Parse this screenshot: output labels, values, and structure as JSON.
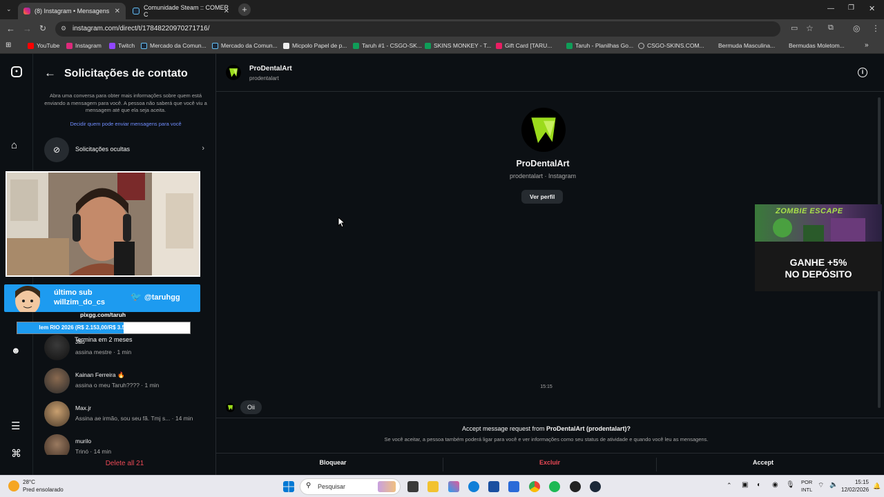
{
  "browser": {
    "tabs": [
      {
        "label": "(8) Instagram • Mensagens",
        "active": true
      },
      {
        "label": "Comunidade Steam :: COMER C",
        "active": false
      }
    ],
    "url": "instagram.com/direct/t/17848220970271716/",
    "bookmarks": [
      "YouTube",
      "Instagram",
      "Twitch",
      "Mercado da Comun...",
      "Mercado da Comun...",
      "Micpolo Papel de p...",
      "Taruh #1 - CSGO-SK...",
      "SKINS MONKEY - T...",
      "Gift Card [TARU...",
      "Taruh - Planilhas Go...",
      "CSGO-SKINS.COM...",
      "Bermuda Masculina...",
      "Bermudas Moletom..."
    ]
  },
  "panel": {
    "title": "Solicitações de contato",
    "info": "Abra uma conversa para obter mais informações sobre quem está enviando a mensagem para você. A pessoa não saberá que você viu a mensagem até que ela seja aceita.",
    "link": "Decidir quem pode enviar mensagens para você",
    "hidden_requests": "Solicitações ocultas",
    "requests": [
      {
        "name": "Jão",
        "preview": "assina mestre · 1 min"
      },
      {
        "name": "Kainan Ferreira 🔥",
        "preview": "assina o meu Taruh???? · 1 min"
      },
      {
        "name": "Max.jr",
        "preview": "Assina ae irmão, sou seu fã. Tmj s... · 14 min"
      },
      {
        "name": "murilo",
        "preview": "Trinó · 14 min"
      }
    ],
    "delete_all": "Delete all 21"
  },
  "overlay": {
    "sub_label": "último sub",
    "sub_name": "willzim_do_cs",
    "twitter": "@taruhgg",
    "pix": "pixgg.com/taruh",
    "goal": "Iem RIO 2026 (R$ 2.153,00/R$ 3.500,00)",
    "goal_progress": 0.615,
    "goal_caption": "Termina em 2 meses"
  },
  "chat": {
    "header_name": "ProDentalArt",
    "header_user": "prodentalart",
    "profile_name": "ProDentalArt",
    "profile_sub": "prodentalart · Instagram",
    "view_profile": "Ver perfil",
    "timestamp": "15:15",
    "message": "Oii",
    "request_question_prefix": "Accept message request from ",
    "request_question_bold": "ProDentalArt (prodentalart)?",
    "request_note": "Se você aceitar, a pessoa também poderá ligar para você e ver informações como seu status de atividade e quando você leu as mensagens.",
    "actions": {
      "block": "Bloquear",
      "delete": "Excluir",
      "accept": "Accept"
    }
  },
  "ad": {
    "title": "ZOMBIE ESCAPE",
    "bonus_line1": "GANHE +5%",
    "bonus_line2": "NO DEPÓSITO"
  },
  "taskbar": {
    "temperature": "28°C",
    "weather": "Pred ensolarado",
    "search": "Pesquisar",
    "lang1": "POR",
    "lang2": "INTL",
    "time": "15:15",
    "date": "12/02/2026"
  },
  "colors": {
    "accent_blue": "#708dff",
    "danger": "#ed4956",
    "brand_green": "#9bdb1c"
  }
}
